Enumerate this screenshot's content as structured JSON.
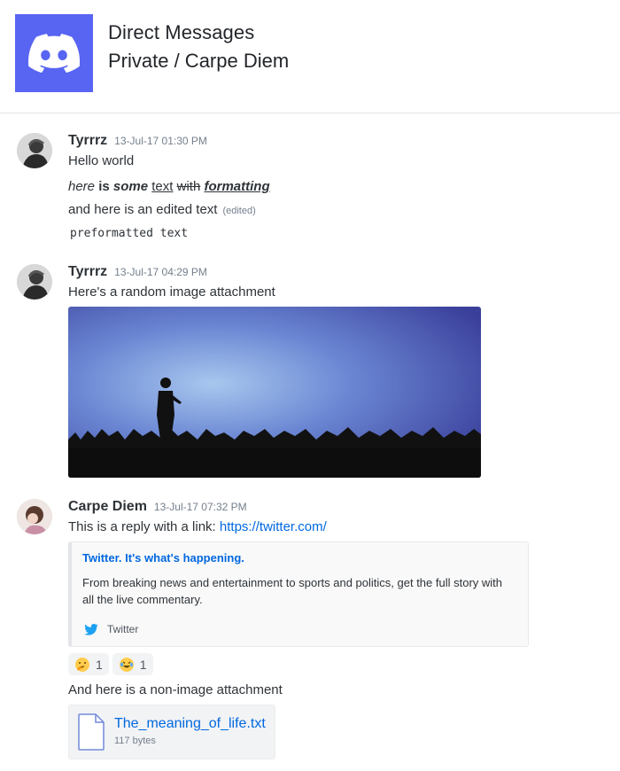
{
  "header": {
    "title": "Direct Messages",
    "subtitle": "Private / Carpe Diem",
    "brand_color": "#5865f2",
    "icon": "discord-logo-icon"
  },
  "messages": [
    {
      "author": "Tyrrrz",
      "timestamp": "13-Jul-17 01:30 PM",
      "lines": {
        "hello": "Hello world",
        "fmt_italic": "here",
        "fmt_bold": "is",
        "fmt_bolditalic": "some",
        "fmt_underline": "text",
        "fmt_strike": "with",
        "fmt_all": "formatting",
        "edited_text": "and here is an edited text",
        "edited_label": "(edited)",
        "preformatted": "preformatted text"
      }
    },
    {
      "author": "Tyrrrz",
      "timestamp": "13-Jul-17 04:29 PM",
      "text": "Here's a random image attachment",
      "attachment": "silhouette-on-stage-image"
    },
    {
      "author": "Carpe Diem",
      "timestamp": "13-Jul-17 07:32 PM",
      "text_prefix": "This is a reply with a link: ",
      "link": "https://twitter.com/",
      "embed": {
        "title": "Twitter. It's what's happening.",
        "description": "From breaking news and entertainment to sports and politics, get the full story with all the live commentary.",
        "footer": "Twitter",
        "footer_icon": "twitter-bird-icon"
      },
      "reactions": [
        {
          "emoji": "thinking-face",
          "count": "1"
        },
        {
          "emoji": "tears-of-joy-face",
          "count": "1"
        }
      ],
      "text2": "And here is a non-image attachment",
      "file": {
        "name": "The_meaning_of_life.txt",
        "size": "117 bytes"
      }
    }
  ],
  "colors": {
    "link": "#0068e0",
    "timestamp": "#747f8d",
    "text": "#2e3338",
    "twitter": "#1da1f2"
  }
}
